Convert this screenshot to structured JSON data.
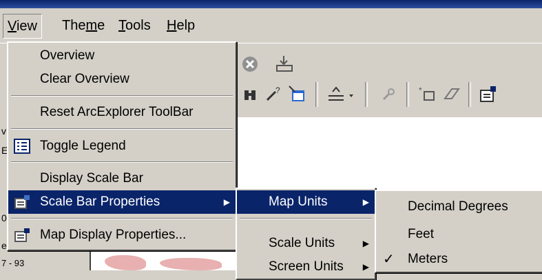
{
  "menubar": {
    "items": [
      {
        "label": "View",
        "underline": "V"
      },
      {
        "label": "Theme",
        "underline": "m"
      },
      {
        "label": "Tools",
        "underline": "T"
      },
      {
        "label": "Help",
        "underline": "H"
      }
    ]
  },
  "view_menu": {
    "items": [
      {
        "label": "Overview"
      },
      {
        "label": "Clear Overview"
      },
      {
        "label": "Reset ArcExplorer ToolBar"
      },
      {
        "label": "Toggle Legend",
        "icon": "legend-icon"
      },
      {
        "label": "Display Scale Bar"
      },
      {
        "label": "Scale Bar Properties",
        "icon": "properties-icon",
        "has_submenu": true,
        "highlighted": true
      },
      {
        "label": "Map Display Properties...",
        "icon": "properties-icon"
      }
    ]
  },
  "scale_bar_submenu": {
    "items": [
      {
        "label": "Map Units",
        "has_submenu": true,
        "highlighted": true
      },
      {
        "label": "Scale Units",
        "has_submenu": true
      },
      {
        "label": "Screen Units",
        "has_submenu": true
      }
    ]
  },
  "map_units_submenu": {
    "items": [
      {
        "label": "Decimal Degrees",
        "checked": false
      },
      {
        "label": "Feet",
        "checked": false
      },
      {
        "label": "Meters",
        "checked": true
      }
    ],
    "check_glyph": "✓"
  },
  "left_strip": {
    "texts": [
      "v",
      "E",
      "0",
      "e",
      "7 - 93"
    ]
  },
  "colors": {
    "menu_bg": "#d4d0c8",
    "highlight": "#0a246a",
    "highlight_text": "#ffffff",
    "title_blue": "#0a246a"
  }
}
